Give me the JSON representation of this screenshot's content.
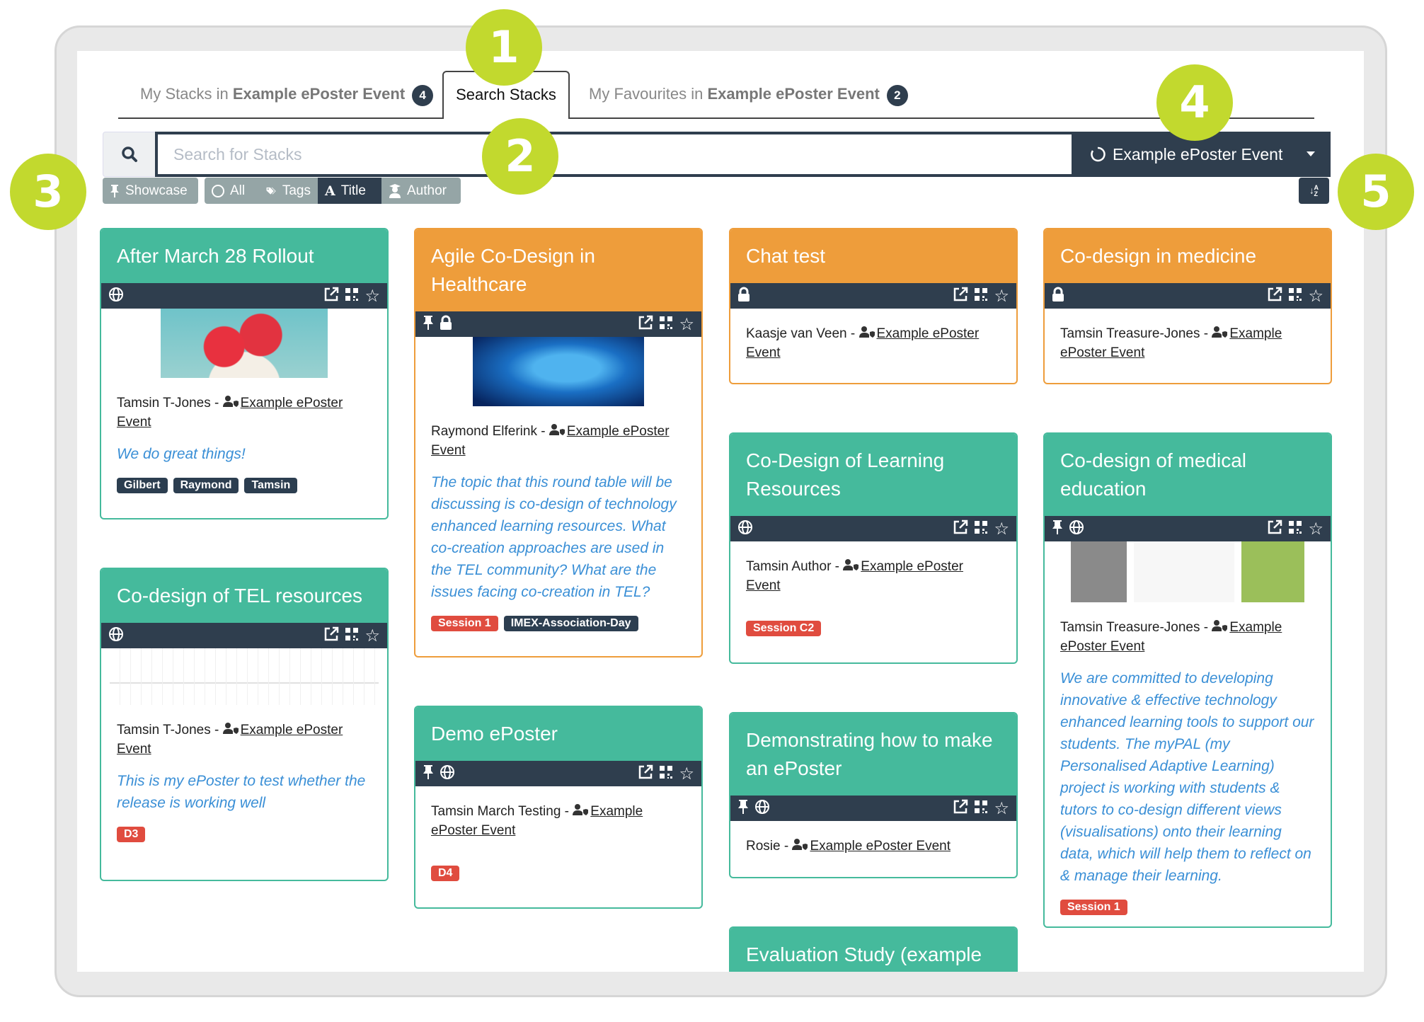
{
  "tabs": [
    {
      "prefix": "My Stacks in ",
      "bold": "Example ePoster Event",
      "badge": "4"
    },
    {
      "label": "Search Stacks"
    },
    {
      "prefix": "My Favourites in ",
      "bold": "Example ePoster Event",
      "badge": "2"
    }
  ],
  "search": {
    "placeholder": "Search for Stacks",
    "value": "",
    "event_selector": "Example ePoster Event"
  },
  "filters": {
    "showcase": "Showcase",
    "all": "All",
    "tags": "Tags",
    "title": "Title",
    "author": "Author",
    "active": "Title",
    "sort_icon": "sort-alpha-icon"
  },
  "callouts": [
    "1",
    "2",
    "3",
    "4",
    "5"
  ],
  "colors": {
    "teal": "#45ba9c",
    "orange": "#ee9d3b",
    "toolbar": "#2f3e4e",
    "tag_dark": "#2c3e50",
    "tag_red": "#e04c3f",
    "callout": "#c2d92e",
    "description": "#3a8fd6"
  },
  "cards": [
    {
      "title": "After March 28 Rollout",
      "color": "#45ba9c",
      "icons": [
        "globe"
      ],
      "image": "hearts",
      "author": "Tamsin T-Jones - ",
      "event": "Example ePoster Event",
      "description": "We do great things!",
      "tags": [
        {
          "label": "Gilbert",
          "color": "#2c3e50"
        },
        {
          "label": "Raymond",
          "color": "#2c3e50"
        },
        {
          "label": "Tamsin",
          "color": "#2c3e50"
        }
      ]
    },
    {
      "title": "Co-design of TEL resources",
      "color": "#45ba9c",
      "icons": [
        "globe"
      ],
      "image": "timeline",
      "author": "Tamsin T-Jones - ",
      "event": "Example ePoster Event",
      "description": "This is my ePoster to test whether the release is working well",
      "tags": [
        {
          "label": "D3",
          "color": "#e04c3f"
        }
      ]
    },
    {
      "title": "Agile Co-Design in Healthcare",
      "color": "#ee9d3b",
      "icons": [
        "pin",
        "lock"
      ],
      "image": "world",
      "author": "Raymond Elferink - ",
      "event": "Example ePoster Event",
      "description": "The topic that this round table will be discussing is co-design of technology enhanced learning resources. What co-creation approaches are used in the TEL community? What are the issues facing co-creation in TEL?",
      "tags": [
        {
          "label": "Session 1",
          "color": "#e04c3f"
        },
        {
          "label": "IMEX-Association-Day",
          "color": "#2c3e50"
        }
      ]
    },
    {
      "title": "Demo ePoster",
      "color": "#45ba9c",
      "icons": [
        "pin",
        "globe"
      ],
      "image": "",
      "author": "Tamsin March Testing - ",
      "event": "Example ePoster Event",
      "description": "",
      "tags": [
        {
          "label": "D4",
          "color": "#e04c3f"
        }
      ]
    },
    {
      "title": "Chat test",
      "color": "#ee9d3b",
      "icons": [
        "lock"
      ],
      "image": "",
      "author": "Kaasje van Veen - ",
      "event": "Example ePoster Event",
      "description": "",
      "tags": []
    },
    {
      "title": "Co-Design of Learning Resources",
      "color": "#45ba9c",
      "icons": [
        "globe"
      ],
      "image": "",
      "author": "Tamsin Author - ",
      "event": "Example ePoster Event",
      "description": "",
      "tags": [
        {
          "label": "Session C2",
          "color": "#e04c3f"
        }
      ]
    },
    {
      "title": "Demonstrating how to make an ePoster",
      "color": "#45ba9c",
      "icons": [
        "pin",
        "globe"
      ],
      "image": "",
      "author": "Rosie - ",
      "event": "Example ePoster Event",
      "description": "",
      "tags": []
    },
    {
      "title": "Evaluation Study (example",
      "color": "#45ba9c",
      "icons": [],
      "image": "",
      "author": "",
      "event": "",
      "description": "",
      "tags": []
    },
    {
      "title": "Co-design in medicine",
      "color": "#ee9d3b",
      "icons": [
        "lock"
      ],
      "image": "",
      "author": "Tamsin Treasure-Jones - ",
      "event": "Example ePoster Event",
      "description": "",
      "tags": []
    },
    {
      "title": "Co-design of medical education",
      "color": "#45ba9c",
      "icons": [
        "pin",
        "globe"
      ],
      "image": "medical",
      "author": "Tamsin Treasure-Jones - ",
      "event": "Example ePoster Event",
      "description": "We are committed to developing innovative & effective technology enhanced learning tools to support our students. The myPAL (my Personalised Adaptive Learning) project is working with students & tutors to co-design different views (visualisations) onto their learning data, which will help them to reflect on & manage their learning.",
      "tags": [
        {
          "label": "Session 1",
          "color": "#e04c3f"
        }
      ]
    }
  ]
}
